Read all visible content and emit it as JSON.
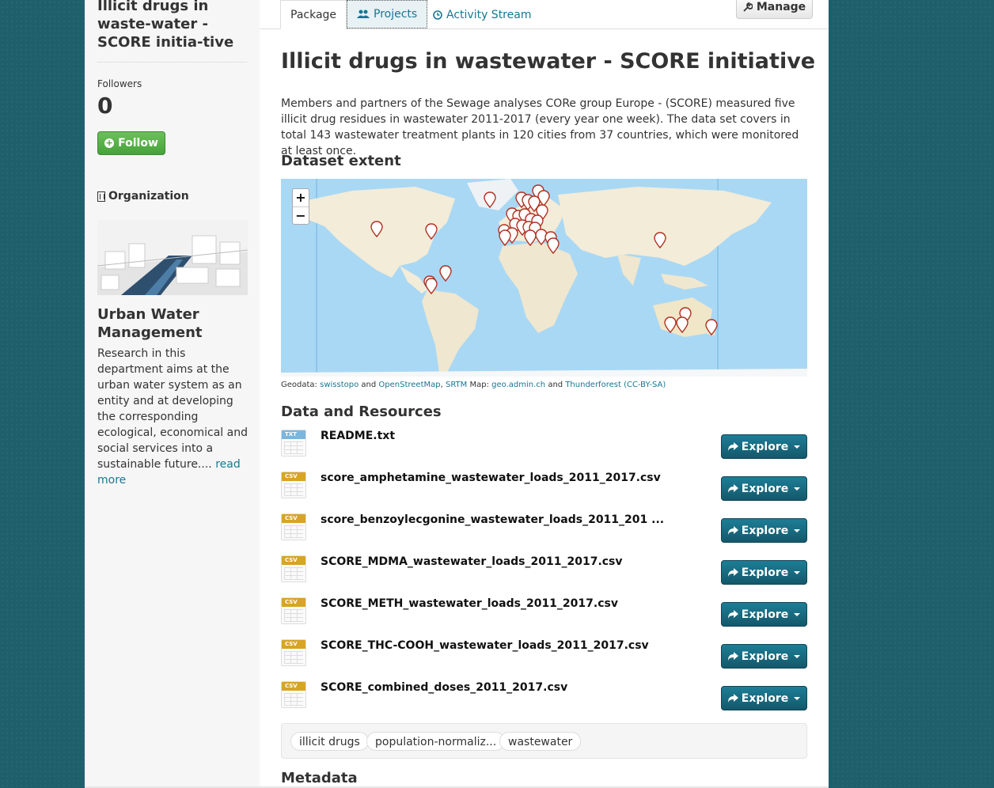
{
  "sidebar": {
    "title": "Illicit drugs in waste-water - SCORE initia-tive",
    "followers_label": "Followers",
    "followers_count": "0",
    "follow_label": "Follow",
    "organization_heading": "Organization",
    "org_name": "Urban Water Management",
    "org_description": "Research in this department aims at the urban water system as an entity and at developing the corresponding ecological, economical and social services into a sustainable future....",
    "read_more": "read more"
  },
  "tabs": {
    "package": "Package",
    "projects": "Projects",
    "activity": "Activity Stream"
  },
  "manage_label": "Manage",
  "dataset": {
    "title": "Illicit drugs in wastewater - SCORE initiative",
    "description": "Members and partners of the Sewage analyses CORe group Europe - (SCORE) measured five illicit drug residues in wastewater 2011-2017 (every year one week). The data set covers in total 143 wastewater treatment plants in 120 cities from 37 countries, which were monitored at least once."
  },
  "extent_heading": "Dataset extent",
  "map": {
    "zoom_in": "+",
    "zoom_out": "−",
    "attribution": {
      "geodata_prefix": "Geodata:",
      "swisstopo": "swisstopo",
      "and1": "and",
      "osm": "OpenStreetMap",
      "comma": ",",
      "srtm": "SRTM",
      "map_prefix": "Map:",
      "geoadmin": "geo.admin.ch",
      "and2": "and",
      "thunderforest": "Thunderforest",
      "license": "(CC-BY-SA)"
    }
  },
  "resources_heading": "Data and Resources",
  "resources": [
    {
      "name": "README.txt",
      "format": "TXT"
    },
    {
      "name": "score_amphetamine_wastewater_loads_2011_2017.csv",
      "format": "CSV"
    },
    {
      "name": "score_benzoylecgonine_wastewater_loads_2011_201 ...",
      "format": "CSV"
    },
    {
      "name": "SCORE_MDMA_wastewater_loads_2011_2017.csv",
      "format": "CSV"
    },
    {
      "name": "SCORE_METH_wastewater_loads_2011_2017.csv",
      "format": "CSV"
    },
    {
      "name": "SCORE_THC-COOH_wastewater_loads_2011_2017.csv",
      "format": "CSV"
    },
    {
      "name": "SCORE_combined_doses_2011_2017.csv",
      "format": "CSV"
    }
  ],
  "explore_label": "Explore",
  "tags": [
    "illicit drugs",
    "population-normaliz...",
    "wastewater"
  ],
  "metadata_heading": "Metadata",
  "colors": {
    "accent": "#187794",
    "follow_green": "#46a23a",
    "explore_blue": "#14586b",
    "marker_red": "#c0392b",
    "background": "#1f5f6b"
  }
}
